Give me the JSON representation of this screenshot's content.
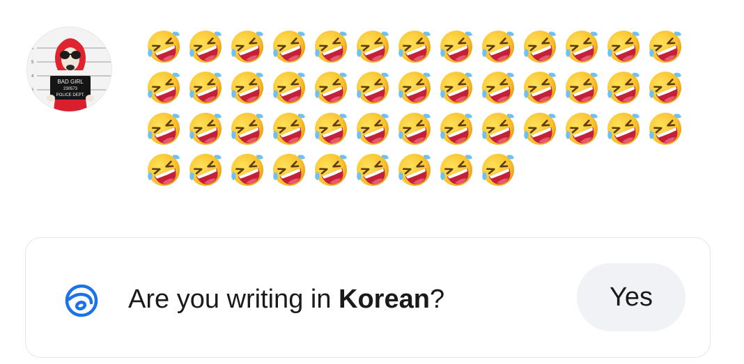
{
  "avatar": {
    "sign_line1": "BAD GIRL",
    "sign_line2": "230573",
    "sign_line3": "POLICE DEPT.",
    "height_marks": [
      "6",
      "5",
      "4",
      "3"
    ]
  },
  "message": {
    "emoji_count": 48,
    "emoji_name": "rolling-on-the-floor-laughing",
    "emoji_char": "🤣"
  },
  "language_prompt": {
    "prefix": "Are you writing in ",
    "language": "Korean",
    "suffix": "?",
    "yes_label": "Yes",
    "icon": "translate-icon",
    "accent_color": "#1a73e8"
  }
}
